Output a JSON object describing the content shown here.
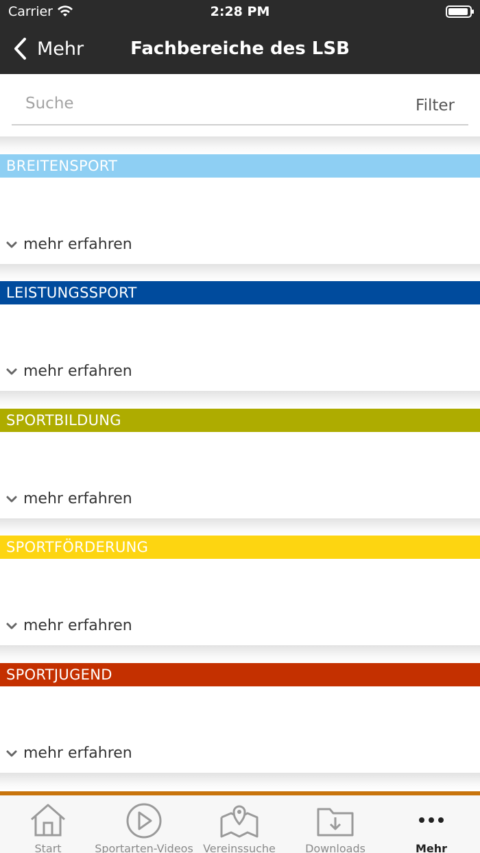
{
  "status": {
    "carrier": "Carrier",
    "time": "2:28 PM"
  },
  "nav": {
    "back_label": "Mehr",
    "title": "Fachbereiche des LSB"
  },
  "search": {
    "placeholder": "Suche",
    "filter_label": "Filter"
  },
  "sections": [
    {
      "title": "BREITENSPORT",
      "color": "#8ecff3",
      "more_label": "mehr erfahren"
    },
    {
      "title": "LEISTUNGSSPORT",
      "color": "#004b9d",
      "more_label": "mehr erfahren"
    },
    {
      "title": "SPORTBILDUNG",
      "color": "#aeac00",
      "more_label": "mehr erfahren"
    },
    {
      "title": "SPORTFÖRDERUNG",
      "color": "#fdd511",
      "more_label": "mehr erfahren"
    },
    {
      "title": "SPORTJUGEND",
      "color": "#c43000",
      "more_label": "mehr erfahren"
    }
  ],
  "tabbar": {
    "accent": "#c8740c",
    "items": [
      {
        "label": "Start",
        "icon": "home-icon"
      },
      {
        "label": "Sportarten-Videos",
        "icon": "play-icon"
      },
      {
        "label": "Vereinssuche",
        "icon": "map-icon"
      },
      {
        "label": "Downloads",
        "icon": "download-folder-icon"
      },
      {
        "label": "Mehr",
        "icon": "more-dots-icon",
        "active": true
      }
    ]
  }
}
